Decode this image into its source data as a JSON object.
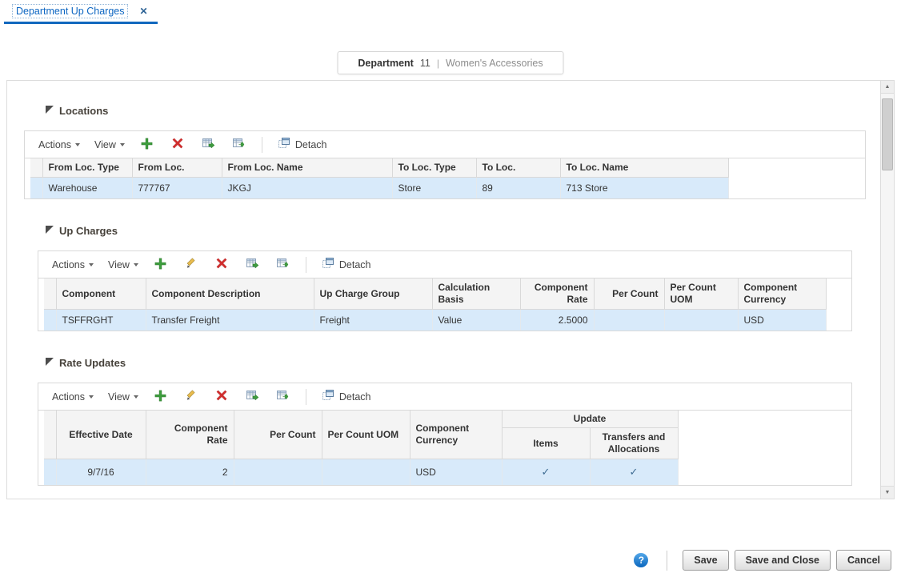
{
  "tab": {
    "title": "Department Up Charges"
  },
  "icons": {
    "tab_close": "✕",
    "scroll_up": "▲",
    "scroll_down": "▼",
    "help": "?"
  },
  "context_header": {
    "label": "Department",
    "id": "11",
    "separator": "|",
    "name": "Women's Accessories"
  },
  "toolbar": {
    "actions": "Actions",
    "view": "View",
    "detach": "Detach"
  },
  "locations": {
    "title": "Locations",
    "columns": [
      "From Loc. Type",
      "From Loc.",
      "From Loc. Name",
      "To Loc. Type",
      "To Loc.",
      "To Loc. Name"
    ],
    "row": [
      "Warehouse",
      "777767",
      "JKGJ",
      "Store",
      "89",
      "713 Store"
    ]
  },
  "up_charges": {
    "title": "Up Charges",
    "columns": [
      "Component",
      "Component Description",
      "Up Charge Group",
      "Calculation Basis",
      "Component Rate",
      "Per Count",
      "Per Count UOM",
      "Component Currency"
    ],
    "row": [
      "TSFFRGHT",
      "Transfer Freight",
      "Freight",
      "Value",
      "2.5000",
      "",
      "",
      "USD"
    ]
  },
  "rate_updates": {
    "title": "Rate Updates",
    "columns": [
      "Effective Date",
      "Component Rate",
      "Per Count",
      "Per Count UOM",
      "Component Currency"
    ],
    "update_group": "Update",
    "update_columns": [
      "Items",
      "Transfers and Allocations"
    ],
    "row": {
      "effective_date": "9/7/16",
      "component_rate": "2",
      "per_count": "",
      "per_count_uom": "",
      "component_currency": "USD",
      "items": "✓",
      "transfers_and_allocations": "✓"
    }
  },
  "footer": {
    "save": "Save",
    "save_and_close": "Save and Close",
    "cancel": "Cancel"
  }
}
